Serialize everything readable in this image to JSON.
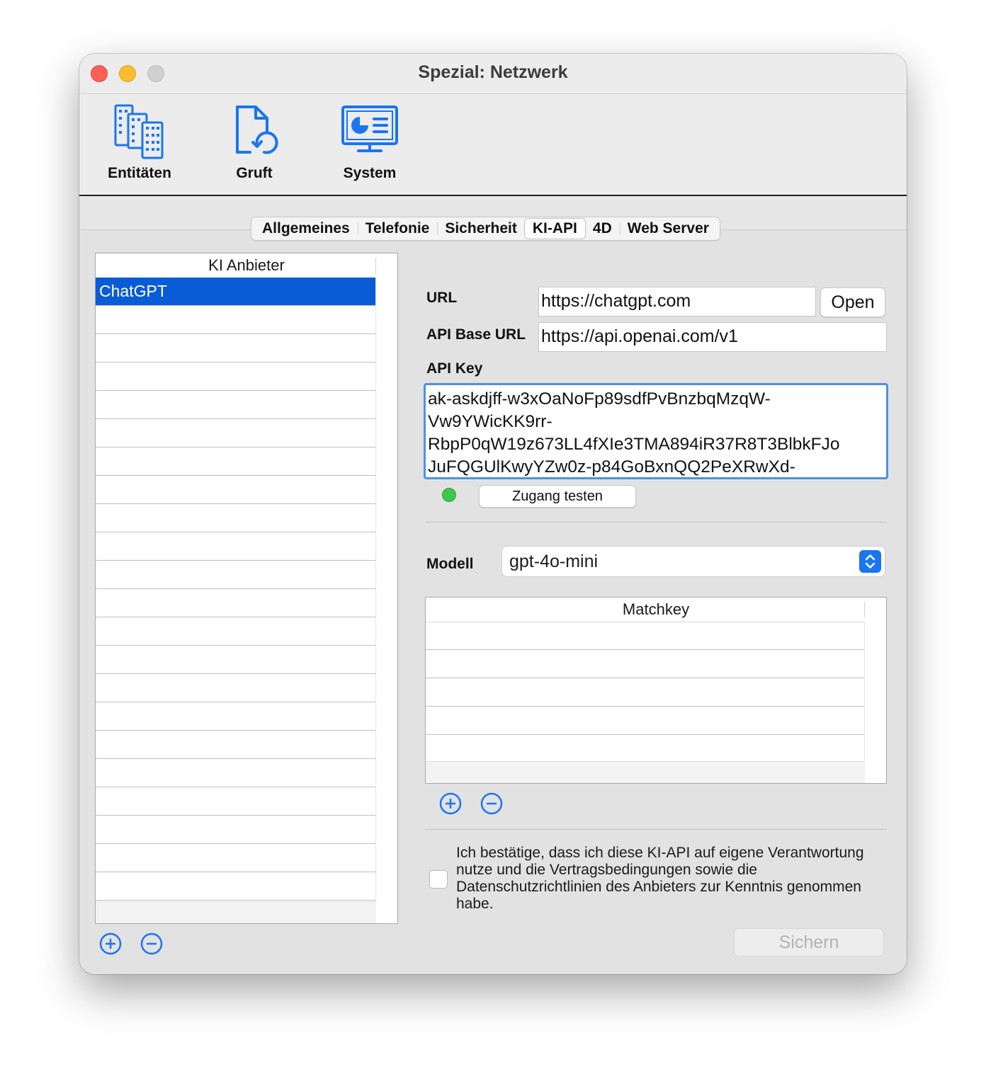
{
  "window": {
    "title": "Spezial: Netzwerk"
  },
  "toolbar": {
    "items": [
      {
        "label": "Entitäten",
        "icon": "buildings-icon"
      },
      {
        "label": "Gruft",
        "icon": "document-restore-icon"
      },
      {
        "label": "System",
        "icon": "system-monitor-icon"
      }
    ]
  },
  "tabs": [
    {
      "label": "Allgemeines"
    },
    {
      "label": "Telefonie"
    },
    {
      "label": "Sicherheit"
    },
    {
      "label": "KI-API",
      "active": true
    },
    {
      "label": "4D"
    },
    {
      "label": "Web Server"
    }
  ],
  "providers": {
    "header": "KI Anbieter",
    "items": [
      "ChatGPT"
    ],
    "selected": "ChatGPT"
  },
  "form": {
    "url_label": "URL",
    "url_value": "https://chatgpt.com",
    "open_label": "Open",
    "base_url_label": "API Base URL",
    "base_url_value": "https://api.openai.com/v1",
    "api_key_label": "API Key",
    "api_key_lines": [
      "ak-askdjff-w3xOaNoFp89sdfPvBnzbqMzqW-",
      "Vw9YWicKK9rr-",
      "RbpP0qW19z673LL4fXIe3TMA894iR37R8T3BlbkFJo",
      "JuFQGUlKwyYZw0z-p84GoBxnQQ2PeXRwXd-"
    ],
    "test_label": "Zugang testen",
    "status_color": "#3cc84b",
    "model_label": "Modell",
    "model_value": "gpt-4o-mini",
    "matchkey_header": "Matchkey",
    "consent_lines": [
      "Ich bestätige, dass ich diese KI-API auf eigene Verantwortung",
      "nutze und die Vertragsbedingungen sowie die",
      "Datenschutzrichtlinien des Anbieters zur Kenntnis genommen",
      "habe."
    ],
    "consent_checked": false,
    "save_label": "Sichern"
  },
  "colors": {
    "accent": "#0a5bd6",
    "icon": "#1a75f0"
  }
}
